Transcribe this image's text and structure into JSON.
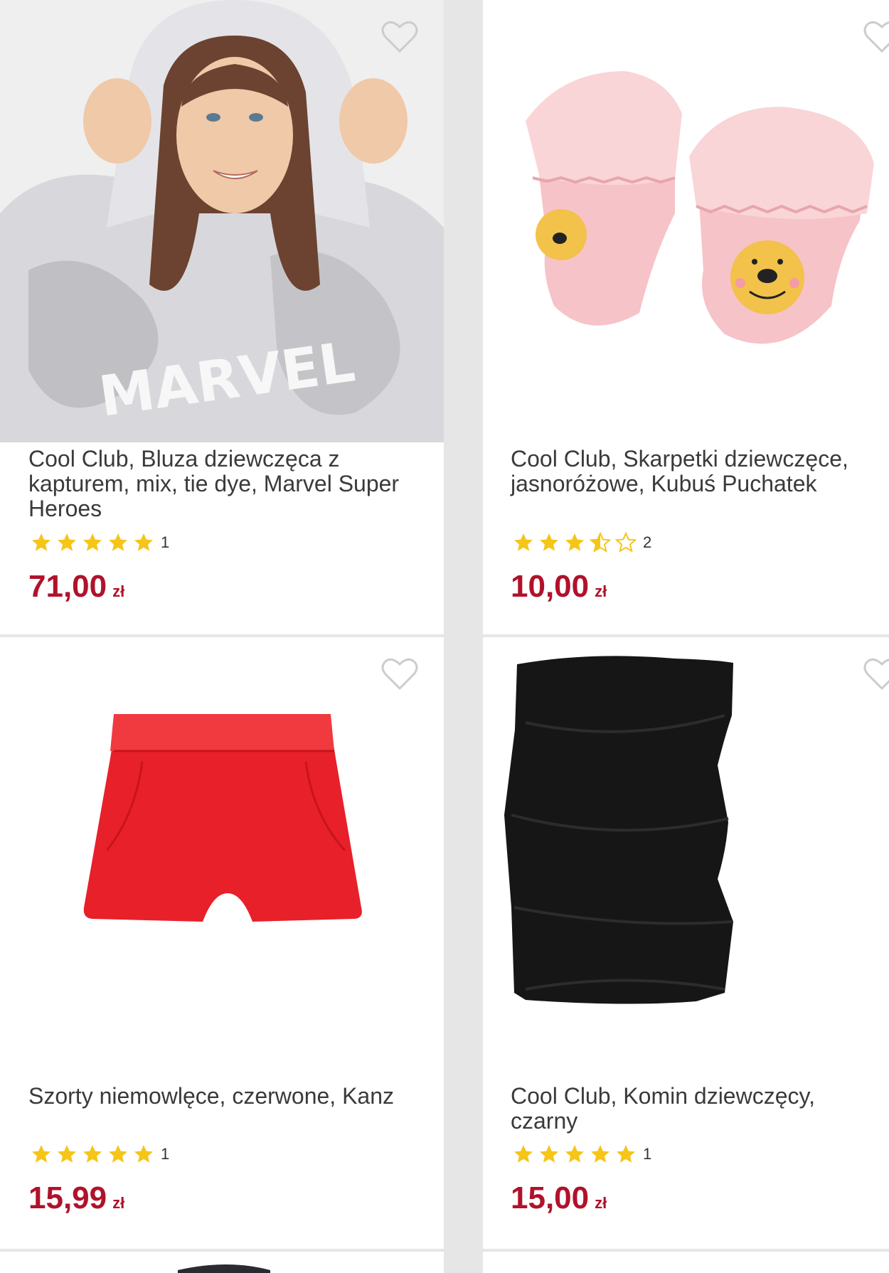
{
  "products": [
    {
      "title": "Cool Club, Bluza dziewczęca z kapturem, mix, tie dye, Marvel Super Heroes",
      "rating": 5,
      "reviews": "1",
      "price": "71,00",
      "currency": "zł"
    },
    {
      "title": "Cool Club, Skarpetki dziewczęce, jasnoróżowe, Kubuś Puchatek",
      "rating": 3.5,
      "reviews": "2",
      "price": "10,00",
      "currency": "zł"
    },
    {
      "title": "Szorty niemowlęce, czerwone, Kanz",
      "rating": 5,
      "reviews": "1",
      "price": "15,99",
      "currency": "zł"
    },
    {
      "title": "Cool Club, Komin dziewczęcy, czarny",
      "rating": 5,
      "reviews": "1",
      "price": "15,00",
      "currency": "zł"
    }
  ],
  "colors": {
    "price": "#b0122b",
    "star": "#f5c518",
    "heart_outline": "#cccccc"
  },
  "icons": {
    "wishlist": "heart-outline-icon",
    "rating": "star-icon"
  }
}
